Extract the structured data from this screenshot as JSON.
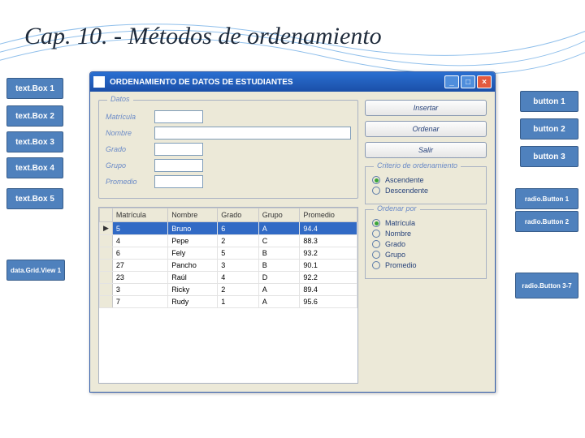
{
  "title": "Cap. 10. - Métodos de ordenamiento",
  "callouts": {
    "tb1": "text.Box 1",
    "tb2": "text.Box 2",
    "tb3": "text.Box 3",
    "tb4": "text.Box 4",
    "tb5": "text.Box 5",
    "dgv": "data.Grid.View 1",
    "b1": "button 1",
    "b2": "button 2",
    "b3": "button 3",
    "rb1": "radio.Button 1",
    "rb2": "radio.Button 2",
    "rb37": "radio.Button 3-7"
  },
  "window": {
    "title": "ORDENAMIENTO DE DATOS DE ESTUDIANTES",
    "min": "_",
    "max": "□",
    "close": "×"
  },
  "datos": {
    "legend": "Datos",
    "matricula_label": "Matrícula",
    "matricula_value": "",
    "nombre_label": "Nombre",
    "nombre_value": "",
    "grado_label": "Grado",
    "grado_value": "",
    "grupo_label": "Grupo",
    "grupo_value": "",
    "promedio_label": "Promedio",
    "promedio_value": ""
  },
  "buttons": {
    "insertar": "Insertar",
    "ordenar": "Ordenar",
    "salir": "Salir"
  },
  "criterio": {
    "legend": "Criterio de ordenamiento",
    "asc": "Ascendente",
    "desc": "Descendente"
  },
  "ordenar_por": {
    "legend": "Ordenar por",
    "matricula": "Matrícula",
    "nombre": "Nombre",
    "grado": "Grado",
    "grupo": "Grupo",
    "promedio": "Promedio"
  },
  "table": {
    "headers": [
      "Matrícula",
      "Nombre",
      "Grado",
      "Grupo",
      "Promedio"
    ],
    "rows": [
      [
        "5",
        "Bruno",
        "6",
        "A",
        "94.4"
      ],
      [
        "4",
        "Pepe",
        "2",
        "C",
        "88.3"
      ],
      [
        "6",
        "Fely",
        "5",
        "B",
        "93.2"
      ],
      [
        "27",
        "Pancho",
        "3",
        "B",
        "90.1"
      ],
      [
        "23",
        "Raúl",
        "4",
        "D",
        "92.2"
      ],
      [
        "3",
        "Ricky",
        "2",
        "A",
        "89.4"
      ],
      [
        "7",
        "Rudy",
        "1",
        "A",
        "95.6"
      ]
    ],
    "selected_row": 0,
    "row_indicator": "▶"
  }
}
